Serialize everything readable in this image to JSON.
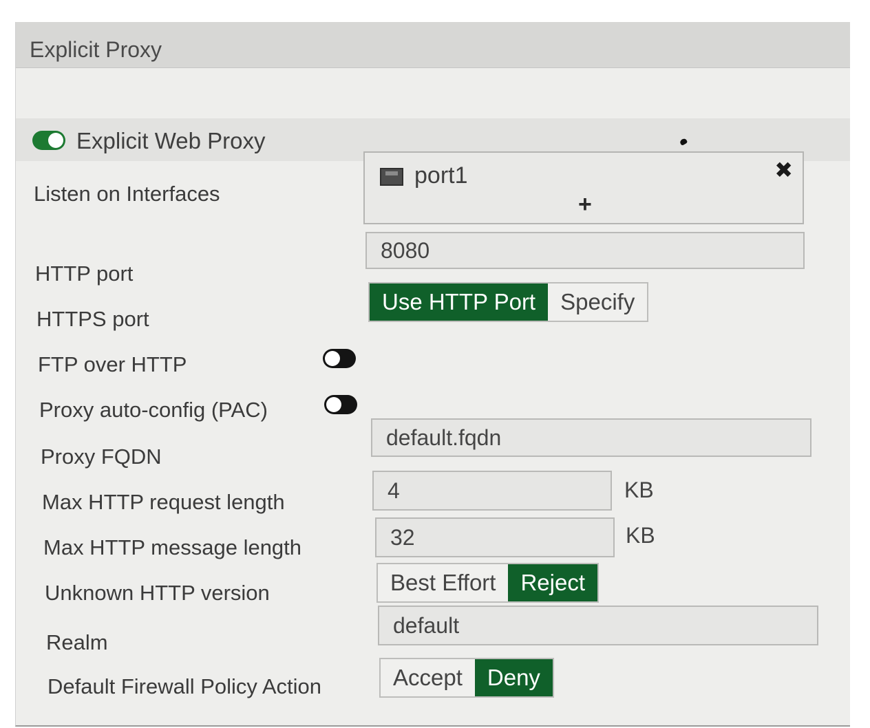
{
  "panel": {
    "title": "Explicit Proxy"
  },
  "explicit_web_proxy": {
    "label": "Explicit Web Proxy",
    "enabled": true
  },
  "listen_on_interfaces": {
    "label": "Listen on Interfaces",
    "items": [
      "port1"
    ],
    "remove_symbol": "✖",
    "add_symbol": "+"
  },
  "http_port": {
    "label": "HTTP port",
    "value": "8080"
  },
  "https_port": {
    "label": "HTTPS port",
    "options": [
      "Use HTTP Port",
      "Specify"
    ],
    "selected": "Use HTTP Port"
  },
  "ftp_over_http": {
    "label": "FTP over HTTP",
    "enabled": false
  },
  "pac": {
    "label": "Proxy auto-config (PAC)",
    "enabled": false
  },
  "proxy_fqdn": {
    "label": "Proxy FQDN",
    "value": "default.fqdn"
  },
  "max_request_length": {
    "label": "Max HTTP request length",
    "value": "4",
    "unit": "KB"
  },
  "max_message_length": {
    "label": "Max HTTP message length",
    "value": "32",
    "unit": "KB"
  },
  "unknown_http_version": {
    "label": "Unknown HTTP version",
    "options": [
      "Best Effort",
      "Reject"
    ],
    "selected": "Reject"
  },
  "realm": {
    "label": "Realm",
    "value": "default"
  },
  "default_policy_action": {
    "label": "Default Firewall Policy Action",
    "options": [
      "Accept",
      "Deny"
    ],
    "selected": "Deny"
  },
  "colors": {
    "accent": "#10602a",
    "toggle_on": "#1d7a32",
    "toggle_off": "#141414",
    "panel_bg": "#eeeeec"
  }
}
